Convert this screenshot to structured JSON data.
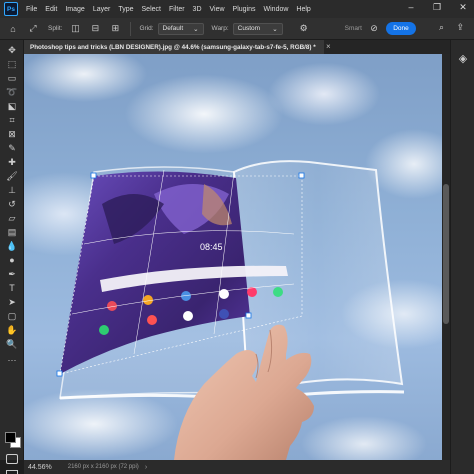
{
  "app": {
    "logo_text": "Ps",
    "menu": [
      "File",
      "Edit",
      "Image",
      "Layer",
      "Type",
      "Select",
      "Filter",
      "3D",
      "View",
      "Plugins",
      "Window",
      "Help"
    ],
    "window_controls": [
      "–",
      "❐",
      "✕"
    ]
  },
  "options_bar": {
    "split_label": "Split:",
    "grid_label": "Grid:",
    "grid_value": "Default",
    "warp_label": "Warp:",
    "warp_value": "Custom",
    "stroke_label": "Smart",
    "done_label": "Done",
    "icons": [
      "home-icon",
      "transform-icon",
      "split-vertical-icon",
      "split-horizontal-icon",
      "split-cross-icon",
      "gear-icon",
      "cancel-icon",
      "search-icon",
      "share-icon"
    ]
  },
  "document": {
    "tab_title": "Photoshop tips and tricks (LBN DESIGNER).jpg @ 44.6% (samsung-galaxy-tab-s7-fe-5, RGB/8) *",
    "tab_close": "×"
  },
  "status": {
    "zoom": "44.56%",
    "doc_info": "2160 px x 2160 px (72 ppi)",
    "arrow": "›"
  },
  "screen_content": {
    "time": "08:45"
  },
  "colors": {
    "accent": "#1473e6",
    "foreground": "#000000",
    "background": "#ffffff",
    "screen_purple": "#4a2f8c"
  }
}
